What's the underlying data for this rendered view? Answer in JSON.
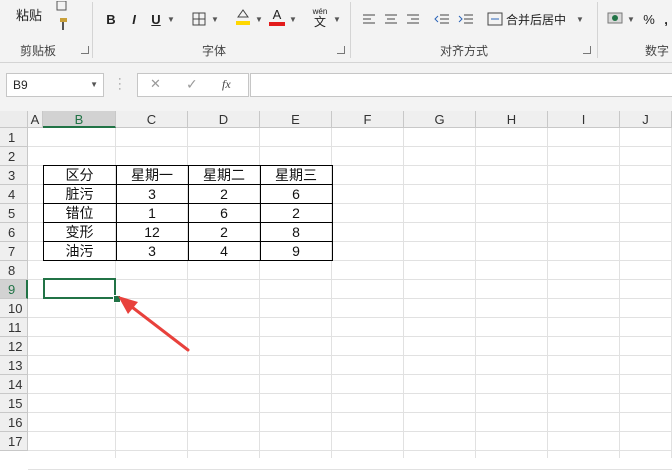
{
  "ribbon": {
    "clipboard": {
      "paste_label": "粘贴",
      "group_label": "剪贴板"
    },
    "font": {
      "bold": "B",
      "italic": "I",
      "underline": "U",
      "font_color_letter": "A",
      "wen_label": "wén",
      "wen_char": "文",
      "group_label": "字体",
      "fill_color": "#ffd700",
      "font_color": "#e21b1b"
    },
    "alignment": {
      "merge_label": "合并后居中",
      "group_label": "对齐方式"
    },
    "number": {
      "percent": "%",
      "comma": ",",
      "group_label": "数字"
    }
  },
  "formula_bar": {
    "name_box": "B9",
    "cancel": "✕",
    "enter": "✓",
    "fx": "fx",
    "value": ""
  },
  "columns": [
    "A",
    "B",
    "C",
    "D",
    "E",
    "F",
    "G",
    "H",
    "I",
    "J"
  ],
  "selected_column": "B",
  "rows": [
    "1",
    "2",
    "3",
    "4",
    "5",
    "6",
    "7",
    "8",
    "9",
    "10",
    "11",
    "12",
    "13",
    "14",
    "15",
    "16",
    "17"
  ],
  "selected_row": "9",
  "table": {
    "header": [
      "区分",
      "星期一",
      "星期二",
      "星期三"
    ],
    "body": [
      [
        "脏污",
        "3",
        "2",
        "6"
      ],
      [
        "错位",
        "1",
        "6",
        "2"
      ],
      [
        "变形",
        "12",
        "2",
        "8"
      ],
      [
        "油污",
        "3",
        "4",
        "9"
      ]
    ]
  },
  "annotation": {
    "arrow_color": "#e8413c"
  }
}
